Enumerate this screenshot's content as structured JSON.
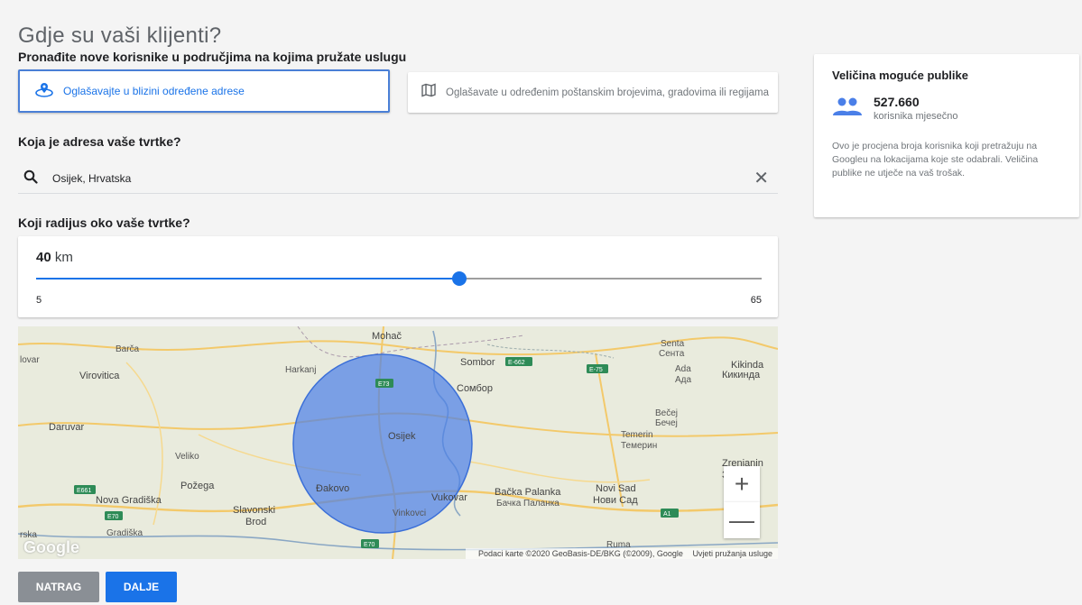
{
  "page": {
    "title": "Gdje su vaši klijenti?",
    "subtitle": "Pronađite nove korisnike u područjima na kojima pružate uslugu"
  },
  "location_options": {
    "near_address": "Oglašavajte u blizini određene adrese",
    "regions": "Oglašavate u određenim poštanskim brojevima, gradovima ili regijama"
  },
  "address": {
    "heading": "Koja je adresa vaše tvrtke?",
    "value": "Osijek, Hrvatska"
  },
  "radius": {
    "heading": "Koji radijus oko vaše tvrtke?",
    "value": 40,
    "unit": "km",
    "min": 5,
    "max": 65
  },
  "map": {
    "labels": [
      "Mohač",
      "Senta",
      "Сента",
      "lovar",
      "Barča",
      "Virovitica",
      "Harkanj",
      "Sombor",
      "Сомбор",
      "Ada",
      "Ада",
      "Kikinda",
      "Кикинда",
      "Bečej",
      "Бечеј",
      "Daruvar",
      "Osijek",
      "Veliko",
      "Temerin",
      "Темерин",
      "Zrenjanin",
      "Зре",
      "Požega",
      "Đakovo",
      "Vukovar",
      "Bačka Palanka",
      "Бачка Паланка",
      "Novi Sad",
      "Нови Сад",
      "Nova Gradiška",
      "Slavonski",
      "Brod",
      "Vinkovci",
      "Gradiška",
      "rska",
      "Ruma"
    ],
    "shields": [
      "E-662",
      "E-75",
      "E73",
      "E661",
      "E70",
      "A1",
      "E70"
    ],
    "zoom_in": "+",
    "zoom_out": "—",
    "logo": "Google",
    "attribution": "Podaci karte ©2020 GeoBasis-DE/BKG (©2009), Google",
    "terms": "Uvjeti pružanja usluge"
  },
  "buttons": {
    "back": "NATRAG",
    "next": "DALJE"
  },
  "audience": {
    "title": "Veličina moguće publike",
    "count": "527.660",
    "count_label": "korisnika mjesečno",
    "description": "Ovo je procjena broja korisnika koji pretražuju na Googleu na lokacijama koje ste odabrali. Veličina publike ne utječe na vaš trošak."
  },
  "colors": {
    "accent": "#1a73e8",
    "radius_circle": "#4a7fe8",
    "back_button": "#8a8f95"
  },
  "icons": {
    "location_option": "location-pin-icon",
    "regions_option": "map-icon",
    "search": "search-icon",
    "clear": "close-icon",
    "audience": "people-icon"
  }
}
